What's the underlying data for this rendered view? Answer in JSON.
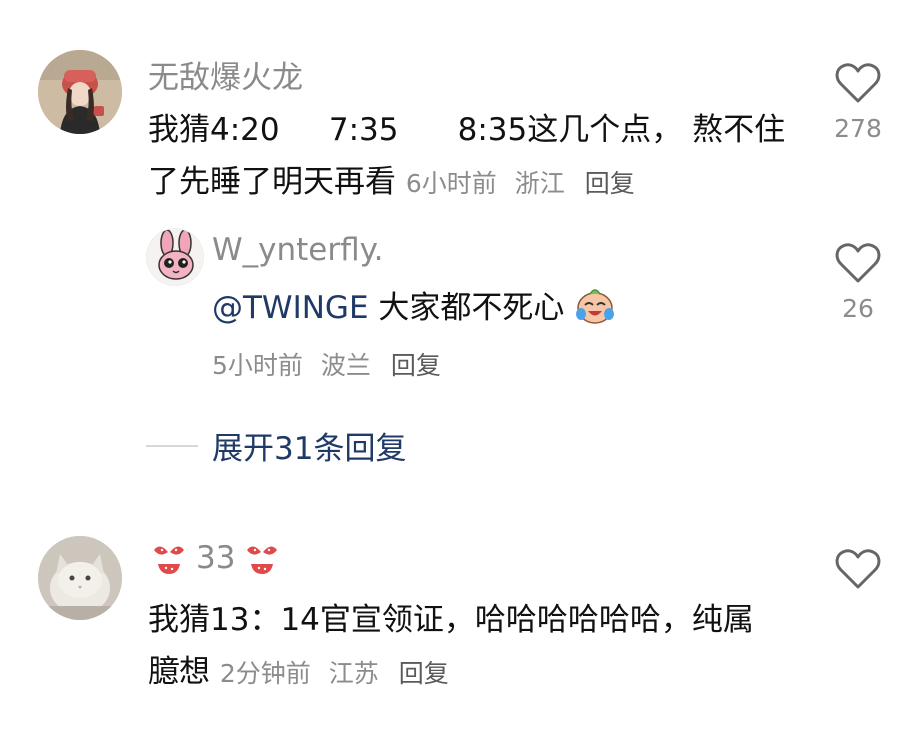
{
  "comments": [
    {
      "username": "无敌爆火龙",
      "text": "我猜4:20     7:35      8:35这几个点， 熬不住了先睡了明天再看",
      "time": "6小时前",
      "location": "浙江",
      "reply_label": "回复",
      "likes": "278",
      "avatar_icon": "girl-avatar"
    },
    {
      "username": "W_ynterfly.",
      "mention": "@TWINGE",
      "text": " 大家都不死心",
      "emoji_icon": "crying-laughing-emoji",
      "time": "5小时前",
      "location": "波兰",
      "reply_label": "回复",
      "likes": "26",
      "avatar_icon": "pink-bunny-avatar"
    },
    {
      "username": "33",
      "text": "我猜13：14官宣领证，哈哈哈哈哈哈，纯属臆想",
      "time": "2分钟前",
      "location": "江苏",
      "reply_label": "回复",
      "likes": "",
      "avatar_icon": "cat-avatar",
      "name_decor_icon": "bikini-emoji"
    }
  ],
  "expand_replies": "展开31条回复",
  "colors": {
    "mention": "#1f3a66",
    "meta": "#8c8c8c",
    "username": "#8a8a8a"
  }
}
